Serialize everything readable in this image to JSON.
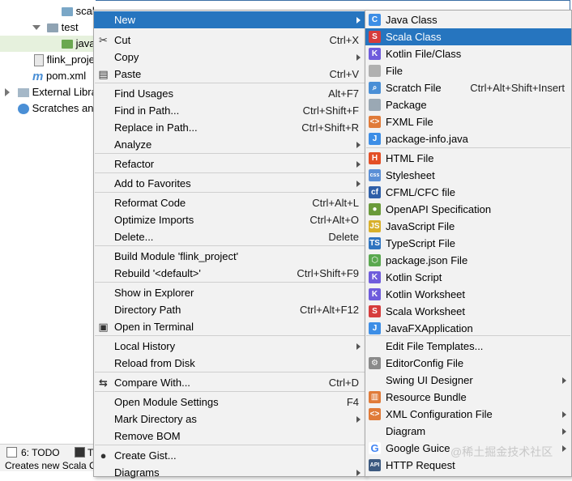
{
  "tree": {
    "scala": "scala",
    "test": "test",
    "java": "java",
    "flink_project": "flink_proje",
    "pom": "pom.xml",
    "external": "External Libra",
    "scratches": "Scratches and"
  },
  "toolbar": {
    "todo": "6: TODO",
    "t": "T"
  },
  "status": {
    "text": "Creates new Scala C"
  },
  "watermark": "@稀土掘金技术社区",
  "menu1": [
    {
      "label": "New",
      "shortcut": "",
      "submenu": true,
      "highlight": true
    },
    {
      "label": "Cut",
      "shortcut": "Ctrl+X"
    },
    {
      "label": "Copy",
      "shortcut": "",
      "submenu": true
    },
    {
      "label": "Paste",
      "shortcut": "Ctrl+V"
    },
    {
      "label": "Find Usages",
      "shortcut": "Alt+F7"
    },
    {
      "label": "Find in Path...",
      "shortcut": "Ctrl+Shift+F"
    },
    {
      "label": "Replace in Path...",
      "shortcut": "Ctrl+Shift+R"
    },
    {
      "label": "Analyze",
      "shortcut": "",
      "submenu": true
    },
    {
      "label": "Refactor",
      "shortcut": "",
      "submenu": true
    },
    {
      "label": "Add to Favorites",
      "shortcut": "",
      "submenu": true
    },
    {
      "label": "Reformat Code",
      "shortcut": "Ctrl+Alt+L"
    },
    {
      "label": "Optimize Imports",
      "shortcut": "Ctrl+Alt+O"
    },
    {
      "label": "Delete...",
      "shortcut": "Delete"
    },
    {
      "label": "Build Module 'flink_project'",
      "shortcut": ""
    },
    {
      "label": "Rebuild '<default>'",
      "shortcut": "Ctrl+Shift+F9"
    },
    {
      "label": "Show in Explorer",
      "shortcut": ""
    },
    {
      "label": "Directory Path",
      "shortcut": "Ctrl+Alt+F12"
    },
    {
      "label": "Open in Terminal",
      "shortcut": ""
    },
    {
      "label": "Local History",
      "shortcut": "",
      "submenu": true
    },
    {
      "label": "Reload from Disk",
      "shortcut": ""
    },
    {
      "label": "Compare With...",
      "shortcut": "Ctrl+D"
    },
    {
      "label": "Open Module Settings",
      "shortcut": "F4"
    },
    {
      "label": "Mark Directory as",
      "shortcut": "",
      "submenu": true
    },
    {
      "label": "Remove BOM",
      "shortcut": ""
    },
    {
      "label": "Create Gist...",
      "shortcut": ""
    },
    {
      "label": "Diagrams",
      "shortcut": "",
      "submenu": true
    }
  ],
  "menu2": [
    {
      "label": "Java Class",
      "shortcut": ""
    },
    {
      "label": "Scala Class",
      "shortcut": "",
      "highlight": true
    },
    {
      "label": "Kotlin File/Class",
      "shortcut": ""
    },
    {
      "label": "File",
      "shortcut": ""
    },
    {
      "label": "Scratch File",
      "shortcut": "Ctrl+Alt+Shift+Insert"
    },
    {
      "label": "Package",
      "shortcut": ""
    },
    {
      "label": "FXML File",
      "shortcut": ""
    },
    {
      "label": "package-info.java",
      "shortcut": ""
    },
    {
      "label": "HTML File",
      "shortcut": ""
    },
    {
      "label": "Stylesheet",
      "shortcut": ""
    },
    {
      "label": "CFML/CFC file",
      "shortcut": ""
    },
    {
      "label": "OpenAPI Specification",
      "shortcut": ""
    },
    {
      "label": "JavaScript File",
      "shortcut": ""
    },
    {
      "label": "TypeScript File",
      "shortcut": ""
    },
    {
      "label": "package.json File",
      "shortcut": ""
    },
    {
      "label": "Kotlin Script",
      "shortcut": ""
    },
    {
      "label": "Kotlin Worksheet",
      "shortcut": ""
    },
    {
      "label": "Scala Worksheet",
      "shortcut": ""
    },
    {
      "label": "JavaFXApplication",
      "shortcut": ""
    },
    {
      "label": "Edit File Templates...",
      "shortcut": ""
    },
    {
      "label": "EditorConfig File",
      "shortcut": ""
    },
    {
      "label": "Swing UI Designer",
      "shortcut": "",
      "submenu": true
    },
    {
      "label": "Resource Bundle",
      "shortcut": ""
    },
    {
      "label": "XML Configuration File",
      "shortcut": "",
      "submenu": true
    },
    {
      "label": "Diagram",
      "shortcut": "",
      "submenu": true
    },
    {
      "label": "Google Guice",
      "shortcut": "",
      "submenu": true
    },
    {
      "label": "HTTP Request",
      "shortcut": ""
    }
  ],
  "icons": {
    "accent": "#2675bf"
  }
}
